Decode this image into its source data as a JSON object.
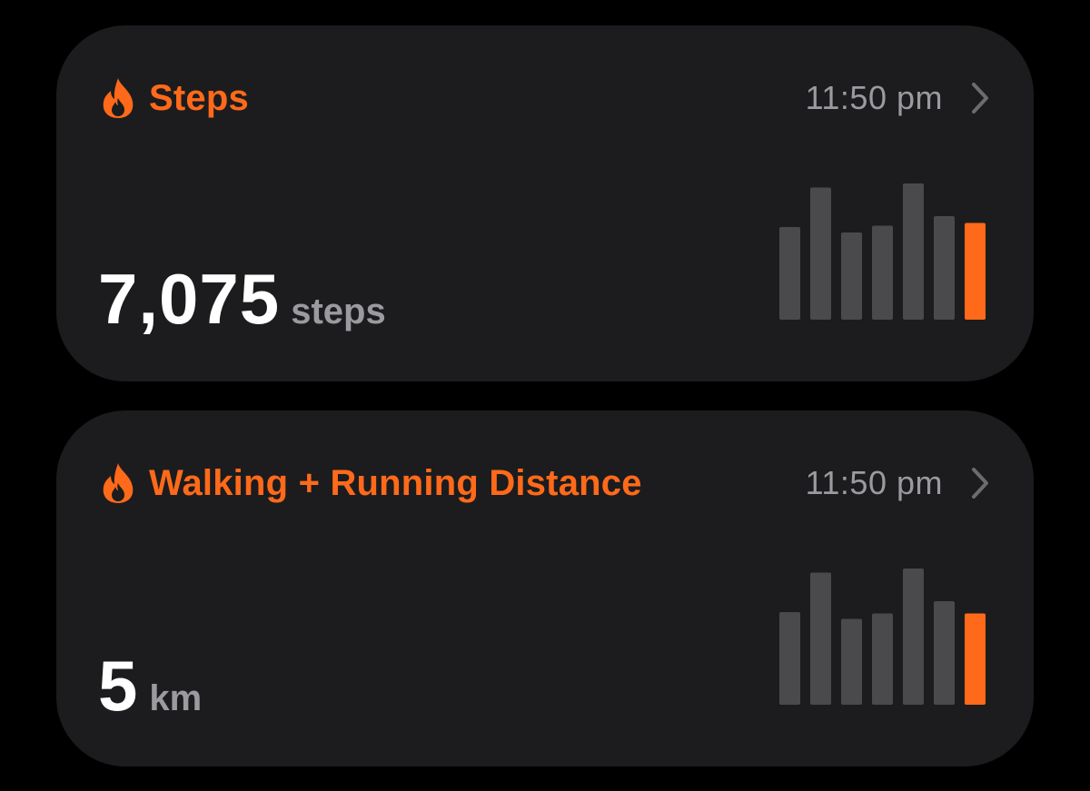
{
  "colors": {
    "background": "#000000",
    "card": "#1c1c1e",
    "accent": "#ff6a1a",
    "secondary_text": "#9a9aa0",
    "bar_inactive": "#4a4a4d"
  },
  "cards": [
    {
      "icon": "flame-icon",
      "title": "Steps",
      "time": "11:50 pm",
      "value": "7,075",
      "unit": "steps",
      "bars": [
        0.68,
        0.97,
        0.64,
        0.69,
        1.0,
        0.76,
        0.71
      ],
      "highlight_index": 6
    },
    {
      "icon": "flame-icon",
      "title": "Walking + Running Distance",
      "time": "11:50 pm",
      "value": "5",
      "unit": "km",
      "bars": [
        0.68,
        0.97,
        0.63,
        0.67,
        1.0,
        0.76,
        0.67
      ],
      "highlight_index": 6
    }
  ]
}
